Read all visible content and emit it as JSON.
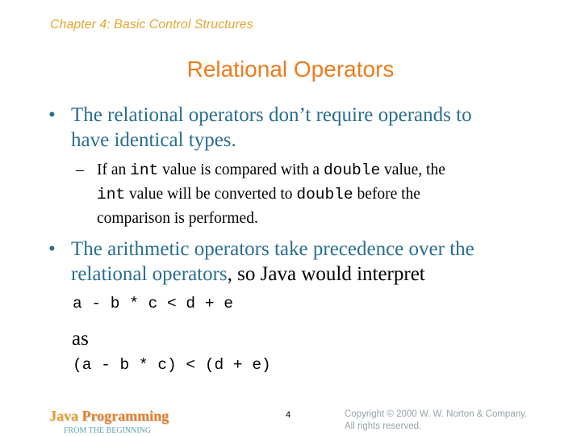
{
  "header": {
    "chapter": "Chapter 4: Basic Control Structures",
    "title": "Relational Operators"
  },
  "bullets": [
    {
      "marker": "•",
      "lines": [
        "The relational operators don’t require operands to",
        "have identical types."
      ],
      "sub": {
        "marker": "–",
        "line1": {
          "t1": "If an ",
          "c1": "int",
          "t2": " value is compared with a ",
          "c2": "double",
          "t3": " value, the"
        },
        "line2": {
          "c1": "int",
          "t1": " value will be converted to ",
          "c2": "double",
          "t2": " before the"
        },
        "line3": "comparison is performed."
      }
    },
    {
      "marker": "•",
      "line1": "The arithmetic operators take precedence over the",
      "line2_blue": "relational operators",
      "line2_black": ", so Java would interpret"
    }
  ],
  "code": {
    "expr1": "a - b * c < d + e",
    "as_word": "as",
    "expr2": "(a - b * c) < (d + e)"
  },
  "footer": {
    "logo_java": "Java ",
    "logo_programming": "Programming",
    "logo_subtitle": "FROM THE BEGINNING",
    "page_number": "4",
    "copyright_line1": "Copyright © 2000 W. W. Norton & Company.",
    "copyright_line2": "All rights reserved."
  },
  "colors": {
    "chapter": "#e3a72f",
    "title": "#ec7c1e",
    "bullet_text": "#2a6e8f",
    "copyright": "#94a5a8"
  }
}
